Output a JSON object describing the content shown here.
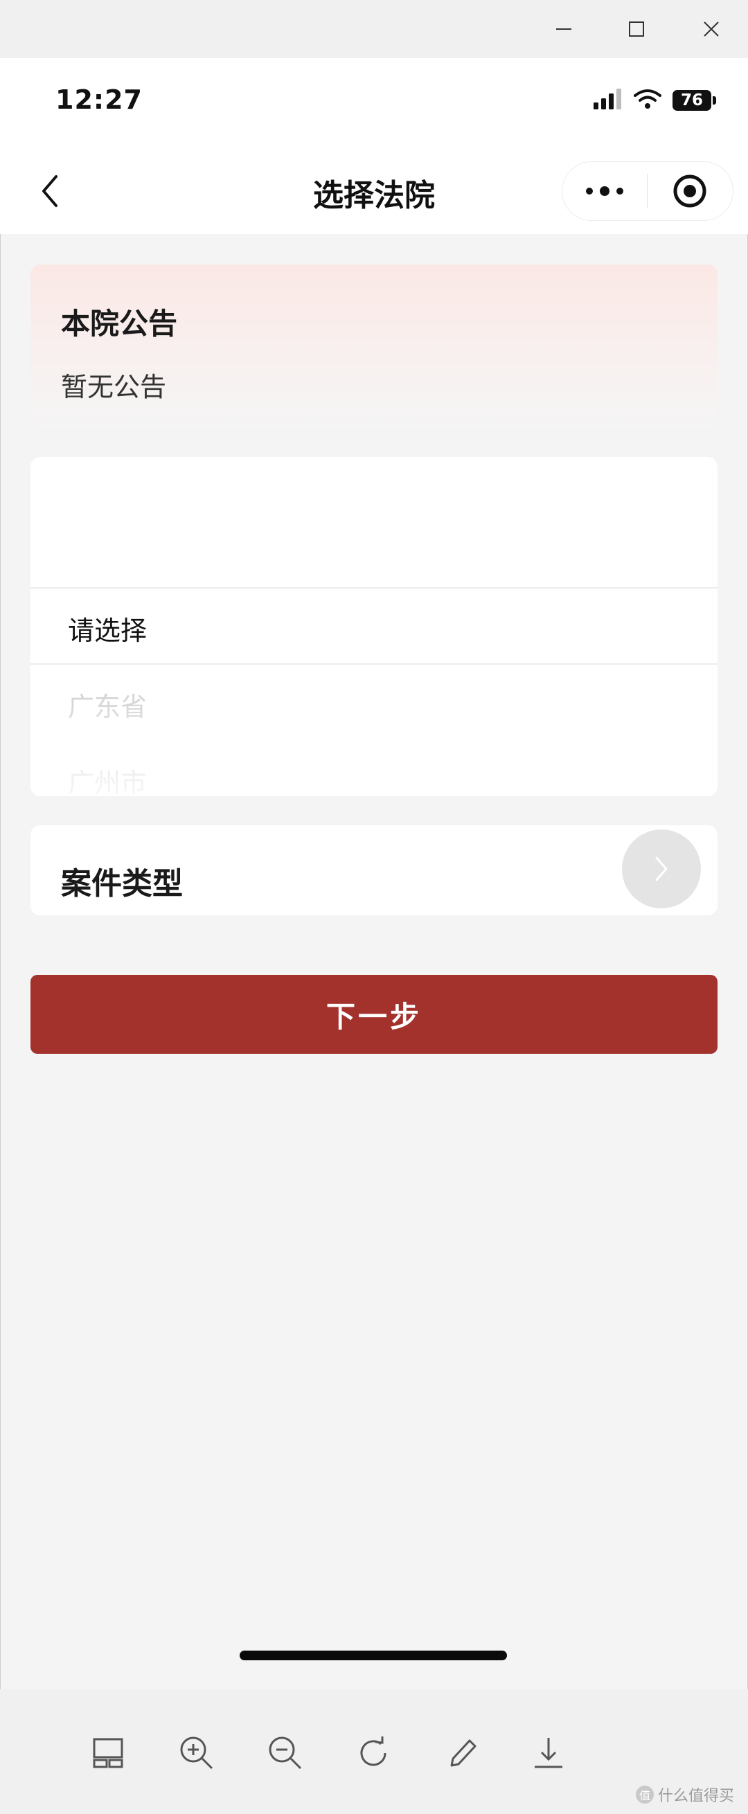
{
  "window": {
    "controls": [
      "minimize-icon",
      "maximize-icon",
      "close-icon"
    ]
  },
  "status_bar": {
    "time": "12:27",
    "battery": "76",
    "icons": [
      "signal-icon",
      "wifi-icon",
      "battery-icon"
    ]
  },
  "nav": {
    "title": "选择法院",
    "back_icon": "chevron-left-icon",
    "more_icon": "more-dots-icon",
    "close_icon": "target-circle-icon"
  },
  "notice": {
    "title": "本院公告",
    "text": "暂无公告"
  },
  "picker": {
    "selected": "请选择",
    "options": [
      "广东省",
      "广州市"
    ]
  },
  "case_type": {
    "label": "案件类型",
    "arrow_icon": "chevron-right-icon"
  },
  "next_button": {
    "label": "下一步",
    "color": "#a3322d"
  },
  "toolbar": {
    "icons": [
      "layout-icon",
      "zoom-in-icon",
      "zoom-out-icon",
      "rotate-icon",
      "edit-pencil-icon",
      "download-icon"
    ]
  },
  "watermark": {
    "badge": "值",
    "text": "什么值得买"
  }
}
